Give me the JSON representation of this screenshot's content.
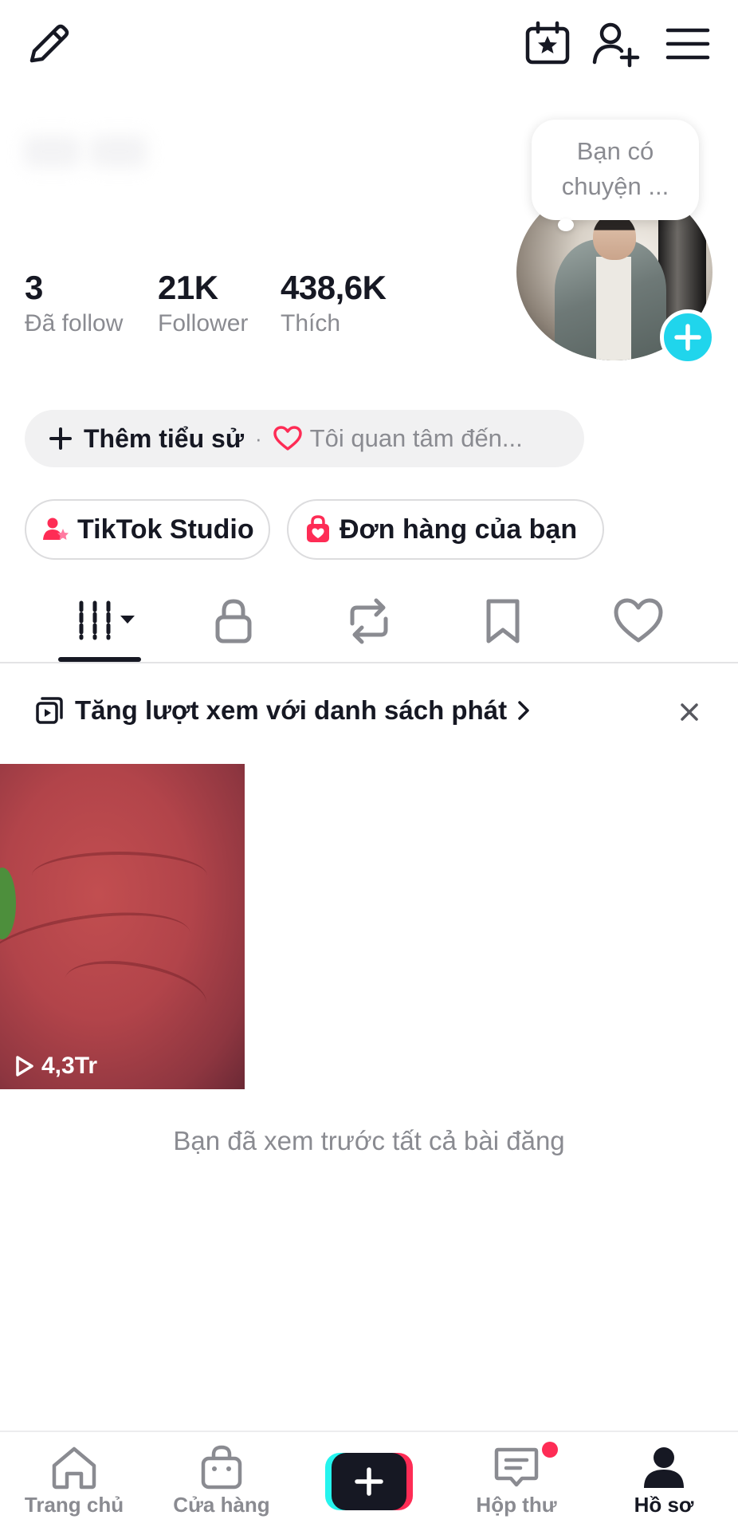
{
  "header": {
    "icons": [
      "edit-icon",
      "calendar-star-icon",
      "add-friend-icon",
      "menu-icon"
    ]
  },
  "profile": {
    "stats": [
      {
        "value": "3",
        "label": "Đã follow"
      },
      {
        "value": "21K",
        "label": "Follower"
      },
      {
        "value": "438,6K",
        "label": "Thích"
      }
    ],
    "bubble_line1": "Bạn có",
    "bubble_line2": "chuyện ..."
  },
  "bio": {
    "add_label": "Thêm tiểu sử",
    "separator": "·",
    "interest_label": "Tôi quan tâm đến..."
  },
  "shortcuts": {
    "studio_label": "TikTok Studio",
    "orders_label": "Đơn hàng của bạn"
  },
  "tabs": [
    "videos-grid-icon",
    "private-lock-icon",
    "repost-icon",
    "bookmark-icon",
    "liked-heart-icon"
  ],
  "playlist": {
    "text": "Tăng lượt xem với danh sách phát"
  },
  "videos": [
    {
      "views": "4,3Tr"
    }
  ],
  "feed_end": "Bạn đã xem trước tất cả bài đăng",
  "bottom_nav": {
    "home": "Trang chủ",
    "shop": "Cửa hàng",
    "inbox": "Hộp thư",
    "profile": "Hồ sơ"
  },
  "colors": {
    "accent_red": "#fe2c55",
    "accent_cyan": "#20d5ec",
    "text_primary": "#161823",
    "text_secondary": "#8a8b91"
  }
}
